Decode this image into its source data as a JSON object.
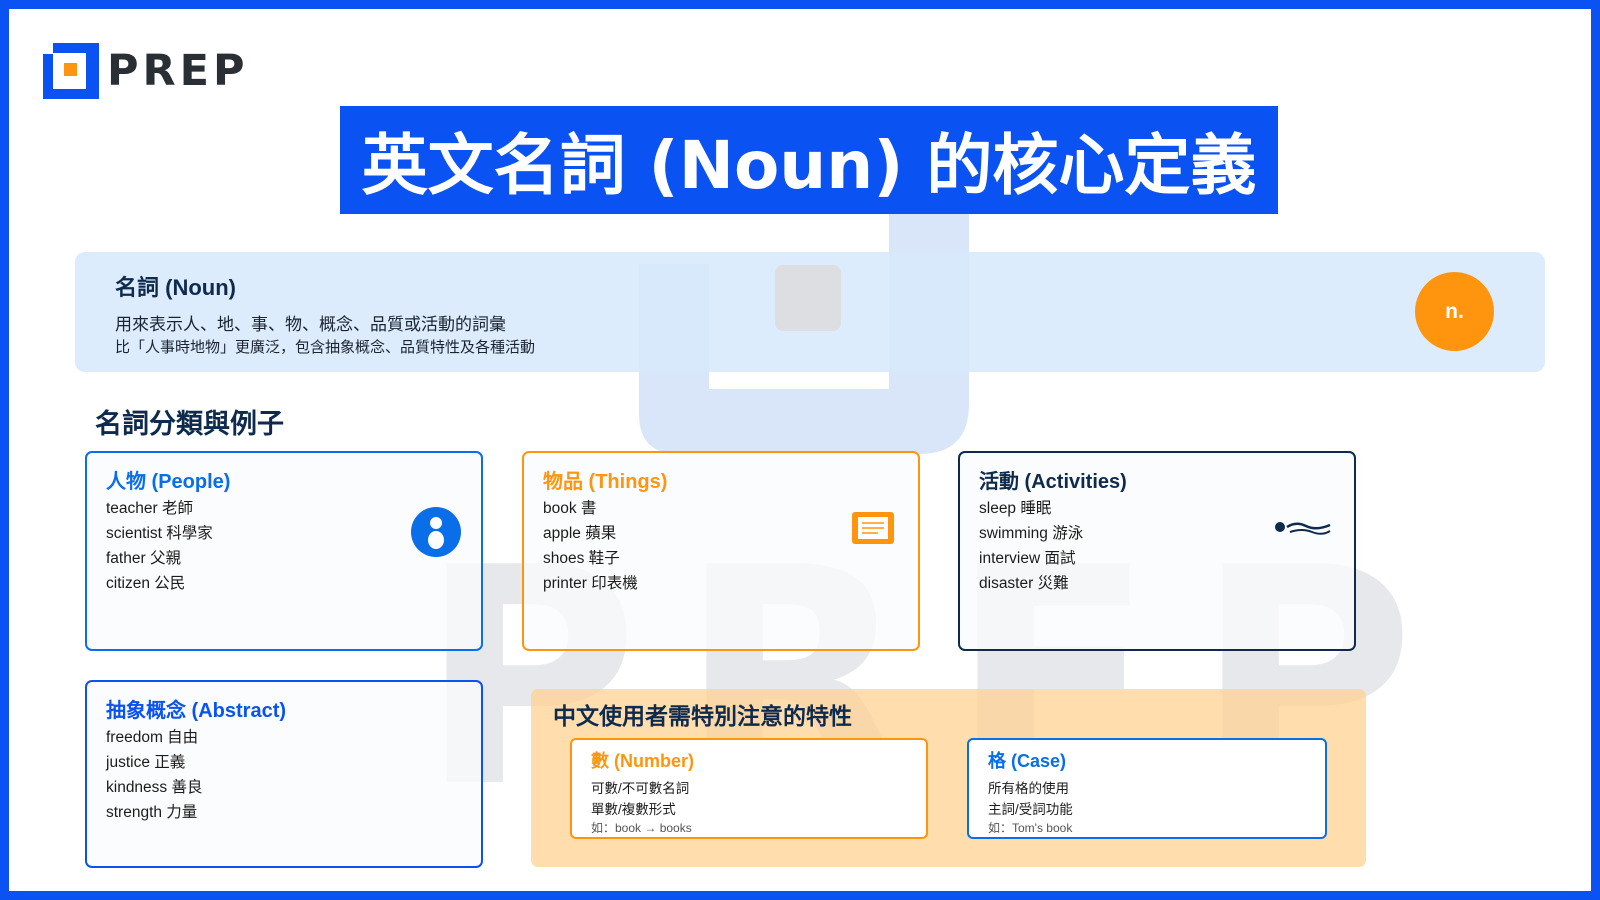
{
  "logo": {
    "text": "PREP"
  },
  "title": "英文名詞 (Noun) 的核心定義",
  "watermark": "PREP",
  "definition": {
    "title": "名詞 (Noun)",
    "line1": "用來表示人、地、事、物、概念、品質或活動的詞彙",
    "line2": "比「人事時地物」更廣泛，包含抽象概念、品質特性及各種活動",
    "badge": "n."
  },
  "section_title": "名詞分類與例子",
  "categories": [
    {
      "title": "人物 (People)",
      "color": "#0a6ee8",
      "icon": "person-icon",
      "items": [
        "teacher 老師",
        "scientist 科學家",
        "father 父親",
        "citizen 公民"
      ]
    },
    {
      "title": "物品 (Things)",
      "color": "#ff950f",
      "icon": "document-icon",
      "items": [
        "book 書",
        "apple 蘋果",
        "shoes 鞋子",
        "printer 印表機"
      ]
    },
    {
      "title": "活動 (Activities)",
      "color": "#0e2a4d",
      "icon": "swimming-icon",
      "items": [
        "sleep 睡眠",
        "swimming 游泳",
        "interview 面試",
        "disaster 災難"
      ]
    },
    {
      "title": "抽象概念 (Abstract)",
      "color": "#0a52f2",
      "items": [
        "freedom 自由",
        "justice 正義",
        "kindness 善良",
        "strength 力量"
      ]
    }
  ],
  "special": {
    "title": "中文使用者需特別注意的特性",
    "number": {
      "title": "數 (Number)",
      "color": "#ff950f",
      "line1": "可數/不可數名詞",
      "line2": "單數/複數形式",
      "example": "如：book → books"
    },
    "case": {
      "title": "格 (Case)",
      "color": "#0a6ee8",
      "line1": "所有格的使用",
      "line2": "主詞/受詞功能",
      "example": "如：Tom's book"
    }
  },
  "colors": {
    "brand_blue": "#0a52f2",
    "accent_orange": "#ff950f",
    "navy": "#0e2a4d",
    "light_blue": "#d6e9fc"
  }
}
